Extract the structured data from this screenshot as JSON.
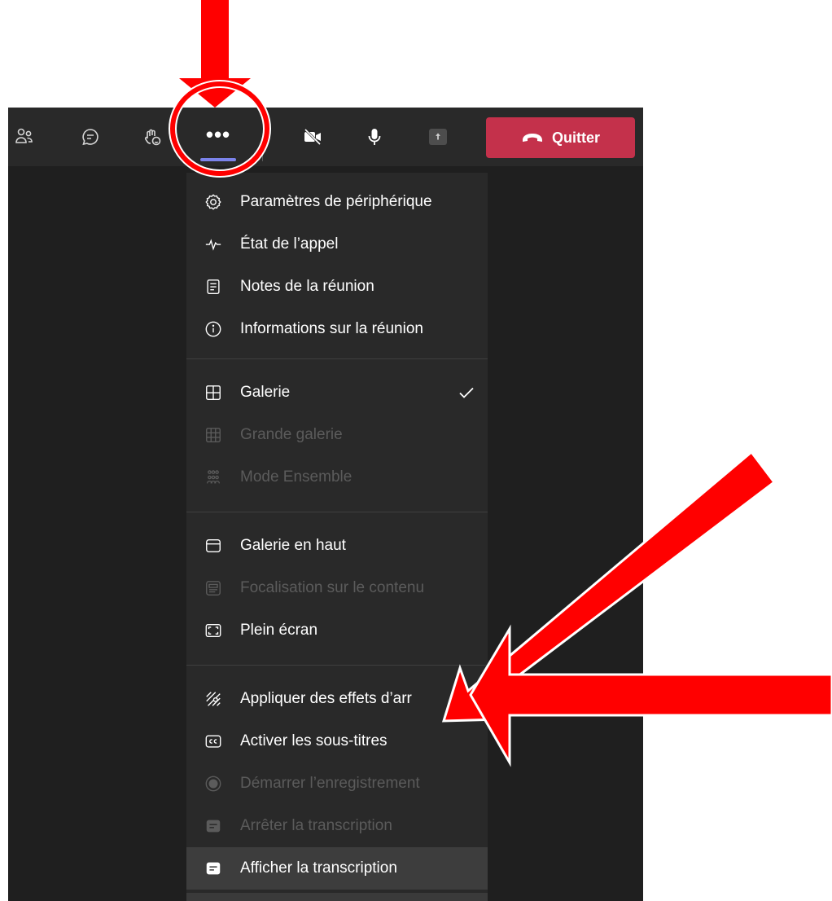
{
  "toolbar": {
    "leave_label": "Quitter",
    "more_glyph": "•••",
    "icons": [
      "people-icon",
      "chat-icon",
      "reactions-icon",
      "more-options-icon",
      "camera-off-icon",
      "microphone-icon",
      "share-tray-icon",
      "hang-up-icon"
    ]
  },
  "menu": {
    "items": [
      {
        "label": "Paramètres de périphérique",
        "icon": "gear-icon",
        "enabled": true
      },
      {
        "label": "État de l’appel",
        "icon": "heartbeat-icon",
        "enabled": true
      },
      {
        "label": "Notes de la réunion",
        "icon": "notes-icon",
        "enabled": true
      },
      {
        "label": "Informations sur la réunion",
        "icon": "info-icon",
        "enabled": true
      },
      {
        "label": "Galerie",
        "icon": "gallery-icon",
        "enabled": true,
        "checked": true
      },
      {
        "label": "Grande galerie",
        "icon": "large-gallery-icon",
        "enabled": false
      },
      {
        "label": "Mode Ensemble",
        "icon": "together-mode-icon",
        "enabled": false
      },
      {
        "label": "Galerie en haut",
        "icon": "gallery-top-icon",
        "enabled": true
      },
      {
        "label": "Focalisation sur le contenu",
        "icon": "content-focus-icon",
        "enabled": false
      },
      {
        "label": "Plein écran",
        "icon": "fullscreen-icon",
        "enabled": true
      },
      {
        "label": "Appliquer des effets d’arr",
        "icon": "background-effects-icon",
        "enabled": true
      },
      {
        "label": "Activer les sous-titres",
        "icon": "closed-captions-icon",
        "enabled": true
      },
      {
        "label": "Démarrer l’enregistrement",
        "icon": "record-icon",
        "enabled": false
      },
      {
        "label": "Arrêter la transcription",
        "icon": "transcript-icon",
        "enabled": false
      },
      {
        "label": "Afficher la transcription",
        "icon": "transcript-icon",
        "enabled": true,
        "highlighted": true
      }
    ]
  },
  "colors": {
    "accent": "#7b83eb",
    "leave": "#c4314b",
    "annotation": "#ff0000",
    "toolbar_bg": "#292929",
    "menu_bg": "#292929",
    "disabled_text": "#5b5b5b"
  },
  "annotations": [
    "down-arrow-annotation",
    "circle-annotation",
    "diagonal-arrow-annotation",
    "left-arrow-annotation"
  ]
}
